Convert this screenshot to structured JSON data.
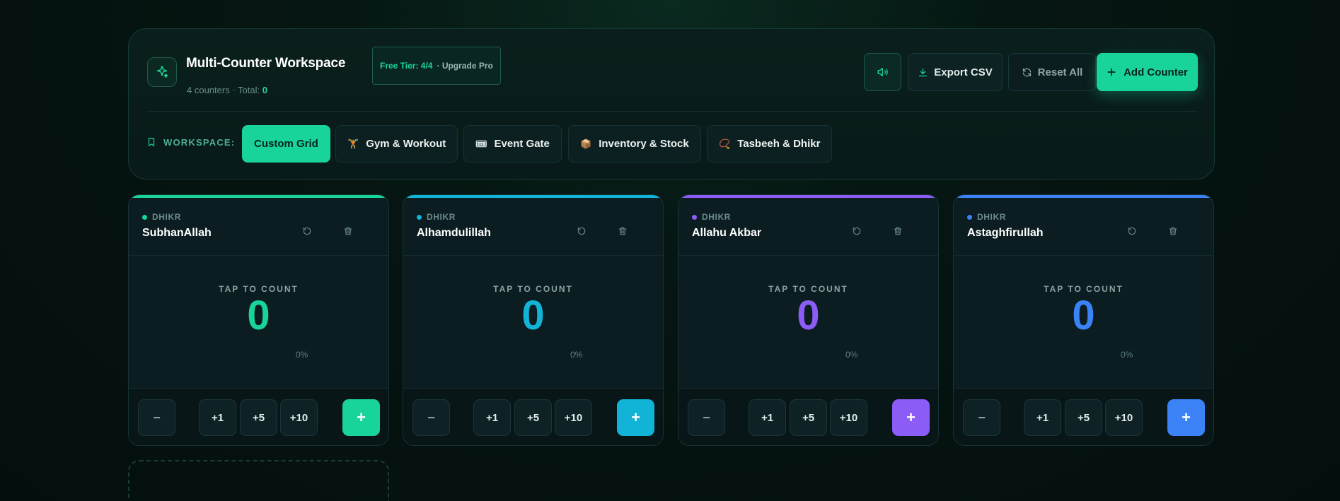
{
  "header": {
    "title": "Multi-Counter Workspace",
    "subtitle_prefix": "4 counters · Total:",
    "total": "0",
    "tier": "Free Tier: 4/4",
    "upgrade": "· Upgrade Pro",
    "export_label": "Export CSV",
    "reset_label": "Reset All",
    "add_label": "Add Counter"
  },
  "workspace": {
    "label": "WORKSPACE:",
    "tabs": [
      {
        "label": "Custom Grid",
        "icon": "",
        "active": true
      },
      {
        "label": "Gym & Workout",
        "icon": "🏋",
        "active": false
      },
      {
        "label": "Event Gate",
        "icon": "🎟",
        "active": false
      },
      {
        "label": "Inventory & Stock",
        "icon": "📦",
        "active": false
      },
      {
        "label": "Tasbeeh & Dhikr",
        "icon": "📿",
        "active": false
      }
    ]
  },
  "colors": {
    "accent": "#19d49a",
    "green": "#19d49a",
    "cyan": "#11b3d6",
    "purple": "#8b5cf6",
    "blue": "#3b82f6"
  },
  "counters": [
    {
      "category": "DHIKR",
      "name": "SubhanAllah",
      "tap": "TAP TO COUNT",
      "count": "0",
      "percent": "0%",
      "color": "#19d49a"
    },
    {
      "category": "DHIKR",
      "name": "Alhamdulillah",
      "tap": "TAP TO COUNT",
      "count": "0",
      "percent": "0%",
      "color": "#11b3d6"
    },
    {
      "category": "DHIKR",
      "name": "Allahu Akbar",
      "tap": "TAP TO COUNT",
      "count": "0",
      "percent": "0%",
      "color": "#8b5cf6"
    },
    {
      "category": "DHIKR",
      "name": "Astaghfirullah",
      "tap": "TAP TO COUNT",
      "count": "0",
      "percent": "0%",
      "color": "#3b82f6"
    }
  ],
  "step_buttons": {
    "minus": "−",
    "p1": "+1",
    "p5": "+5",
    "p10": "+10",
    "plus": "+"
  }
}
